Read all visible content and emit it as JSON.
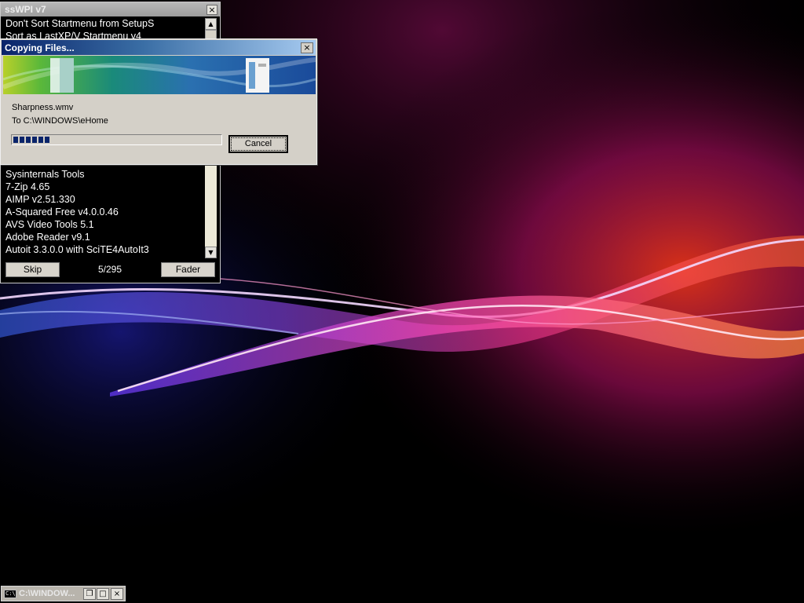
{
  "sswpi": {
    "title": "ssWPI v7",
    "close_label": "×",
    "items": [
      "Don't Sort Startmenu from SetupS",
      "Sort as LastXP/V Startmenu v4",
      "",
      "",
      "",
      "",
      "",
      "",
      "",
      "",
      "",
      "",
      "Sysinternals Tools",
      "7-Zip 4.65",
      "AIMP v2.51.330",
      "A-Squared Free v4.0.0.46",
      "AVS Video Tools 5.1",
      "Adobe Reader v9.1",
      "Autoit 3.3.0.0 with SciTE4AutoIt3"
    ],
    "skip_label": "Skip",
    "counter": "5/295",
    "fader_label": "Fader",
    "scroll_up": "▲",
    "scroll_down": "▼"
  },
  "copy_dialog": {
    "title": "Copying Files...",
    "close_label": "×",
    "filename": "Sharpness.wmv",
    "destination": "To C:\\WINDOWS\\eHome",
    "progress_percent": 18,
    "cancel_label": "Cancel"
  },
  "taskbar": {
    "window_title": "C:\\WINDOW...",
    "icon_text": "C:\\",
    "restore_label": "❐",
    "maximize_label": "□",
    "close_label": "×"
  },
  "colors": {
    "desktop_background": "#000000",
    "ribbon_violet": "#7a3cff",
    "ribbon_magenta": "#ff2e8c",
    "ribbon_orange": "#ff5a1e",
    "dialog_title": "#0a246a"
  }
}
